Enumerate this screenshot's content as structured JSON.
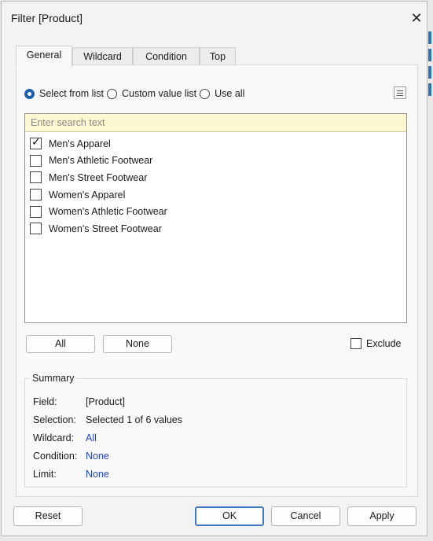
{
  "window": {
    "title": "Filter [Product]",
    "close_glyph": "✕"
  },
  "tabs": [
    {
      "label": "General",
      "active": true
    },
    {
      "label": "Wildcard",
      "active": false
    },
    {
      "label": "Condition",
      "active": false
    },
    {
      "label": "Top",
      "active": false
    }
  ],
  "mode": {
    "options": [
      {
        "label": "Select from list",
        "selected": true
      },
      {
        "label": "Custom value list",
        "selected": false
      },
      {
        "label": "Use all",
        "selected": false
      }
    ]
  },
  "list": {
    "search_placeholder": "Enter search text",
    "items": [
      {
        "label": "Men's Apparel",
        "checked": true
      },
      {
        "label": "Men's Athletic Footwear",
        "checked": false
      },
      {
        "label": "Men's Street Footwear",
        "checked": false
      },
      {
        "label": "Women's Apparel",
        "checked": false
      },
      {
        "label": "Women's Athletic Footwear",
        "checked": false
      },
      {
        "label": "Women's Street Footwear",
        "checked": false
      }
    ]
  },
  "select_buttons": {
    "all_label": "All",
    "none_label": "None"
  },
  "exclude": {
    "label": "Exclude",
    "checked": false
  },
  "summary": {
    "title": "Summary",
    "field_label": "Field:",
    "field_value": "[Product]",
    "selection_label": "Selection:",
    "selection_value": "Selected 1 of 6 values",
    "wildcard_label": "Wildcard:",
    "wildcard_value": "All",
    "condition_label": "Condition:",
    "condition_value": "None",
    "limit_label": "Limit:",
    "limit_value": "None"
  },
  "footer": {
    "reset_label": "Reset",
    "ok_label": "OK",
    "cancel_label": "Cancel",
    "apply_label": "Apply"
  },
  "colors": {
    "accent": "#1b5fb0",
    "link": "#2044c9",
    "search_bg": "#fdf8cf"
  }
}
